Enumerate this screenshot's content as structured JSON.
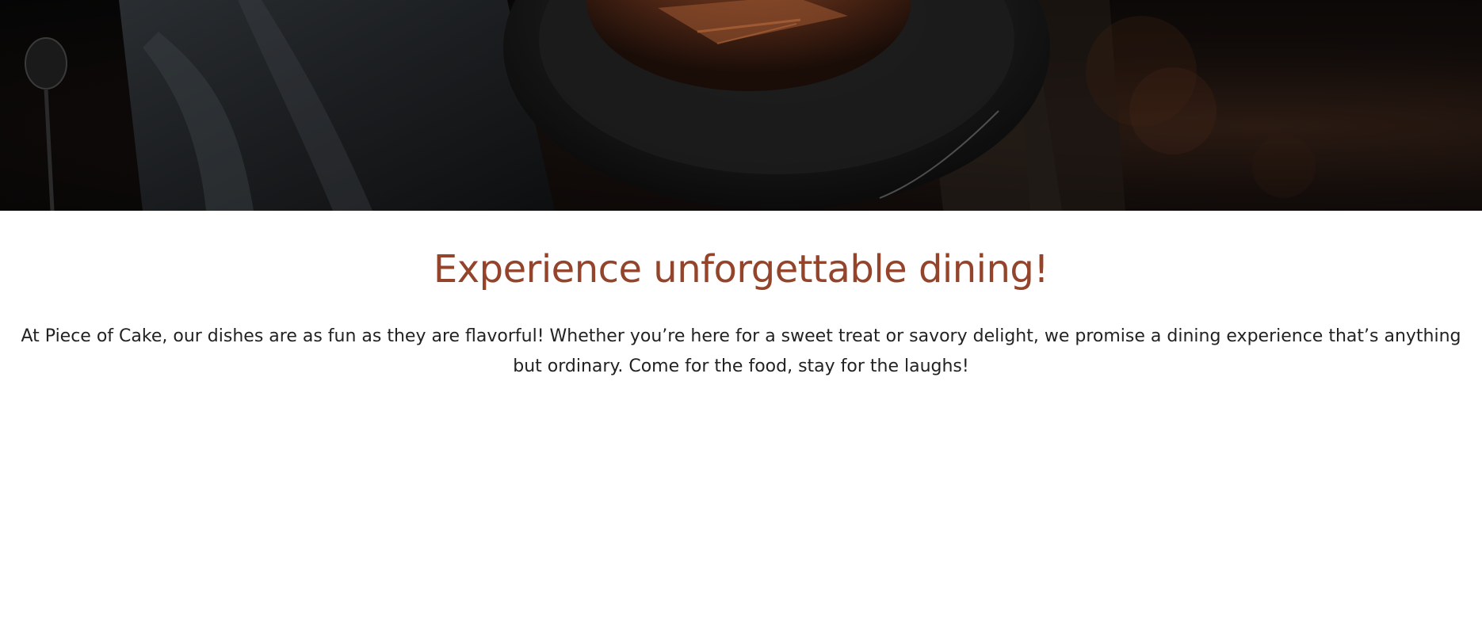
{
  "hero": {
    "image_icon": "dessert-plate-photo"
  },
  "intro": {
    "headline": "Experience unforgettable dining!",
    "body": "At Piece of Cake, our dishes are as fun as they are flavorful! Whether you’re here for a sweet treat or savory delight, we promise a dining experience that’s anything but ordinary. Come for the food, stay for the laughs!"
  },
  "colors": {
    "headline": "#93442b",
    "body_text": "#222222",
    "hero_dark": "#050505",
    "cocoa": "#8a4a28"
  }
}
